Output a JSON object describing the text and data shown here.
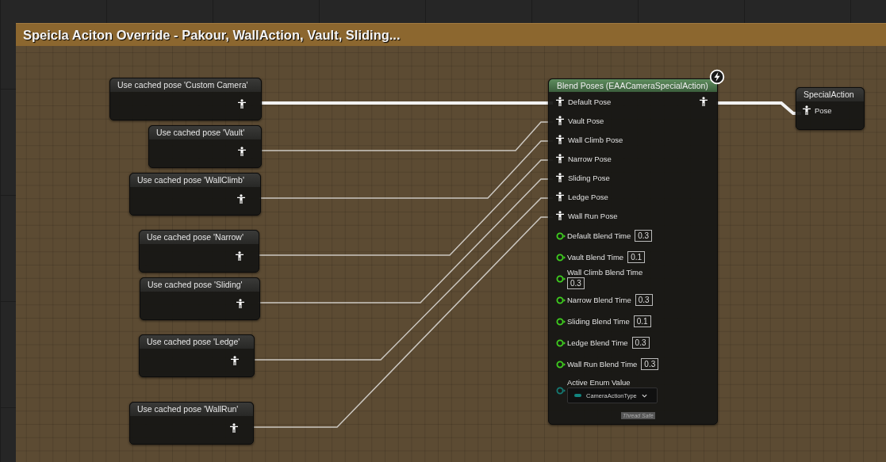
{
  "comment": {
    "title": "Speicla Aciton Override - Pakour, WallAction, Vault, Sliding..."
  },
  "cached_pose_nodes": [
    {
      "title": "Use cached pose 'Custom Camera'"
    },
    {
      "title": "Use cached pose 'Vault'"
    },
    {
      "title": "Use cached pose 'WallClimb'"
    },
    {
      "title": "Use cached pose 'Narrow'"
    },
    {
      "title": "Use cached pose 'Sliding'"
    },
    {
      "title": "Use cached pose 'Ledge'"
    },
    {
      "title": "Use cached pose 'WallRun'"
    }
  ],
  "blend_node": {
    "title": "Blend Poses (EAACameraSpecialAction)",
    "pose_inputs": [
      "Default Pose",
      "Vault Pose",
      "Wall Climb Pose",
      "Narrow Pose",
      "Sliding Pose",
      "Ledge Pose",
      "Wall Run Pose"
    ],
    "blend_times": [
      {
        "label": "Default Blend Time",
        "value": "0.3"
      },
      {
        "label": "Vault Blend Time",
        "value": "0.1"
      },
      {
        "label": "Wall Climb Blend Time",
        "value": "0.3"
      },
      {
        "label": "Narrow Blend Time",
        "value": "0.3"
      },
      {
        "label": "Sliding Blend Time",
        "value": "0.1"
      },
      {
        "label": "Ledge Blend Time",
        "value": "0.3"
      },
      {
        "label": "Wall Run Blend Time",
        "value": "0.3"
      }
    ],
    "active_enum": {
      "label": "Active Enum Value",
      "value": "CameraActionType"
    },
    "badge": "Thread Safe"
  },
  "output_node": {
    "title": "SpecialAction",
    "pin_label": "Pose"
  }
}
